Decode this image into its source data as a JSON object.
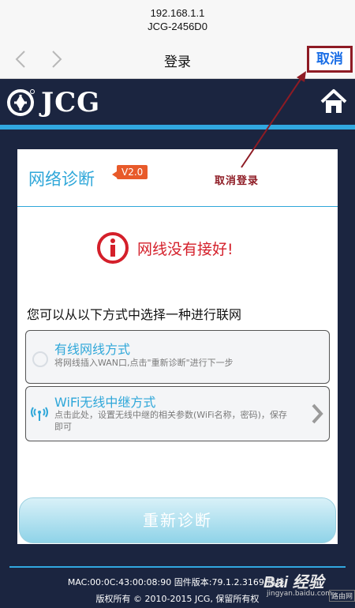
{
  "browser": {
    "url_line1": "192.168.1.1",
    "url_line2": "JCG-2456D0",
    "title": "登录",
    "cancel_label": "取消"
  },
  "app": {
    "brand": "JCG"
  },
  "card": {
    "title": "网络诊断",
    "version": "V2.0",
    "error_text": "网线没有接好!",
    "choose_text": "您可以从以下方式中选择一种进行联网",
    "options": [
      {
        "title": "有线网线方式",
        "desc": "将网线插入WAN口,点击\"重新诊断\"进行下一步",
        "icon": "wired-icon"
      },
      {
        "title": "WiFi无线中继方式",
        "desc": "点击此处，设置无线中继的相关参数(WiFi名称，密码)，保存即可",
        "icon": "wifi-signal-icon"
      }
    ],
    "rediagnose_label": "重新诊断"
  },
  "annotation": {
    "text": "取消登录"
  },
  "footer": {
    "line1": "MAC:00:0C:43:00:08:90 固件版本:79.1.2.3169 热线:",
    "line2": "版权所有 © 2010-2015 JCG, 保留所有权"
  },
  "watermark": {
    "brand": "Bai  经验",
    "site": "jingyan.baidu.com",
    "tag": "路由网"
  },
  "colors": {
    "accent": "#2fa7d9",
    "error": "#d41f2a",
    "header_bg": "#1b2540",
    "annotation": "#8e1b24"
  }
}
